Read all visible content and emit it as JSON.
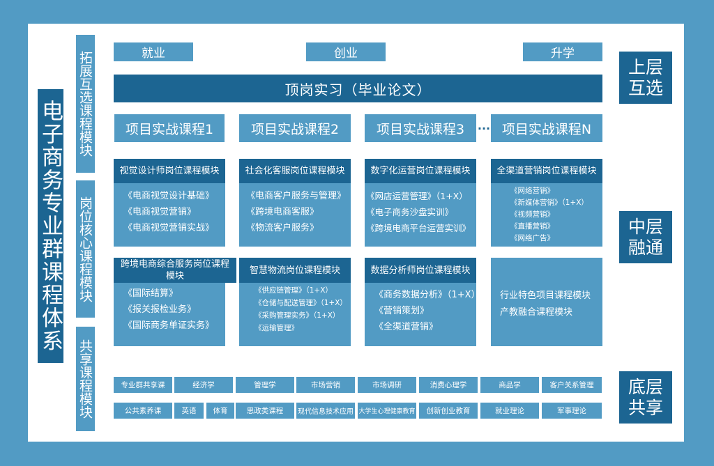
{
  "title": "电子商务专业群课程体系",
  "module_labels": {
    "expand": "拓展互选课程模块",
    "core": "岗位核心课程模块",
    "shared": "共享课程模块"
  },
  "layers": {
    "upper": [
      "上层",
      "互选"
    ],
    "middle": [
      "中层",
      "融通"
    ],
    "bottom": [
      "底层",
      "共享"
    ]
  },
  "outcomes": [
    "就业",
    "创业",
    "升学"
  ],
  "internship": "顶岗实习（毕业论文）",
  "projects": [
    "项目实战课程1",
    "项目实战课程2",
    "项目实战课程3",
    "项目实战课程N"
  ],
  "ellipsis": "···",
  "core_modules": [
    {
      "title": "视觉设计师岗位课程模块",
      "courses": [
        "《电商视觉设计基础》",
        "《电商视觉营销》",
        "《电商视觉营销实战》"
      ]
    },
    {
      "title": "社会化客服岗位课程模块",
      "courses": [
        "《电商客户服务与管理》",
        "《跨境电商客服》",
        "《物流客户服务》"
      ]
    },
    {
      "title": "数字化运营岗位课程模块",
      "courses": [
        "《网店运营管理》（1+X）",
        "《电子商务沙盘实训》",
        "《跨境电商平台运营实训》"
      ]
    },
    {
      "title": "全渠道营销岗位课程模块",
      "courses": [
        "《网络营销》",
        "《新媒体营销》（1+X）",
        "《视频营销》",
        "《直播营销》",
        "《网络广告》"
      ]
    },
    {
      "title": "跨境电商综合服务岗位课程模块",
      "courses": [
        "《国际结算》",
        "《报关报检业务》",
        "《国际商务单证实务》"
      ]
    },
    {
      "title": "智慧物流岗位课程模块",
      "courses": [
        "《供应链管理》（1+X）",
        "《仓储与配送管理》（1+X）",
        "《采购管理实务》（1+X）",
        "《运输管理》"
      ]
    },
    {
      "title": "数据分析师岗位课程模块",
      "courses": [
        "《商务数据分析》（1+X）",
        "《营销策划》",
        "《全渠道营销》"
      ]
    }
  ],
  "special_modules": [
    "行业特色项目课程模块",
    "产教融合课程模块"
  ],
  "shared_rows": [
    [
      "专业群共享课",
      "经济学",
      "管理学",
      "市场营销",
      "市场调研",
      "消费心理学",
      "商品学",
      "客户关系管理"
    ],
    [
      "公共素养课",
      "英语",
      "体育",
      "思政类课程",
      "现代信息技术应用",
      "大学生心理健康教育",
      "创新创业教育",
      "就业理论",
      "军事理论"
    ]
  ]
}
